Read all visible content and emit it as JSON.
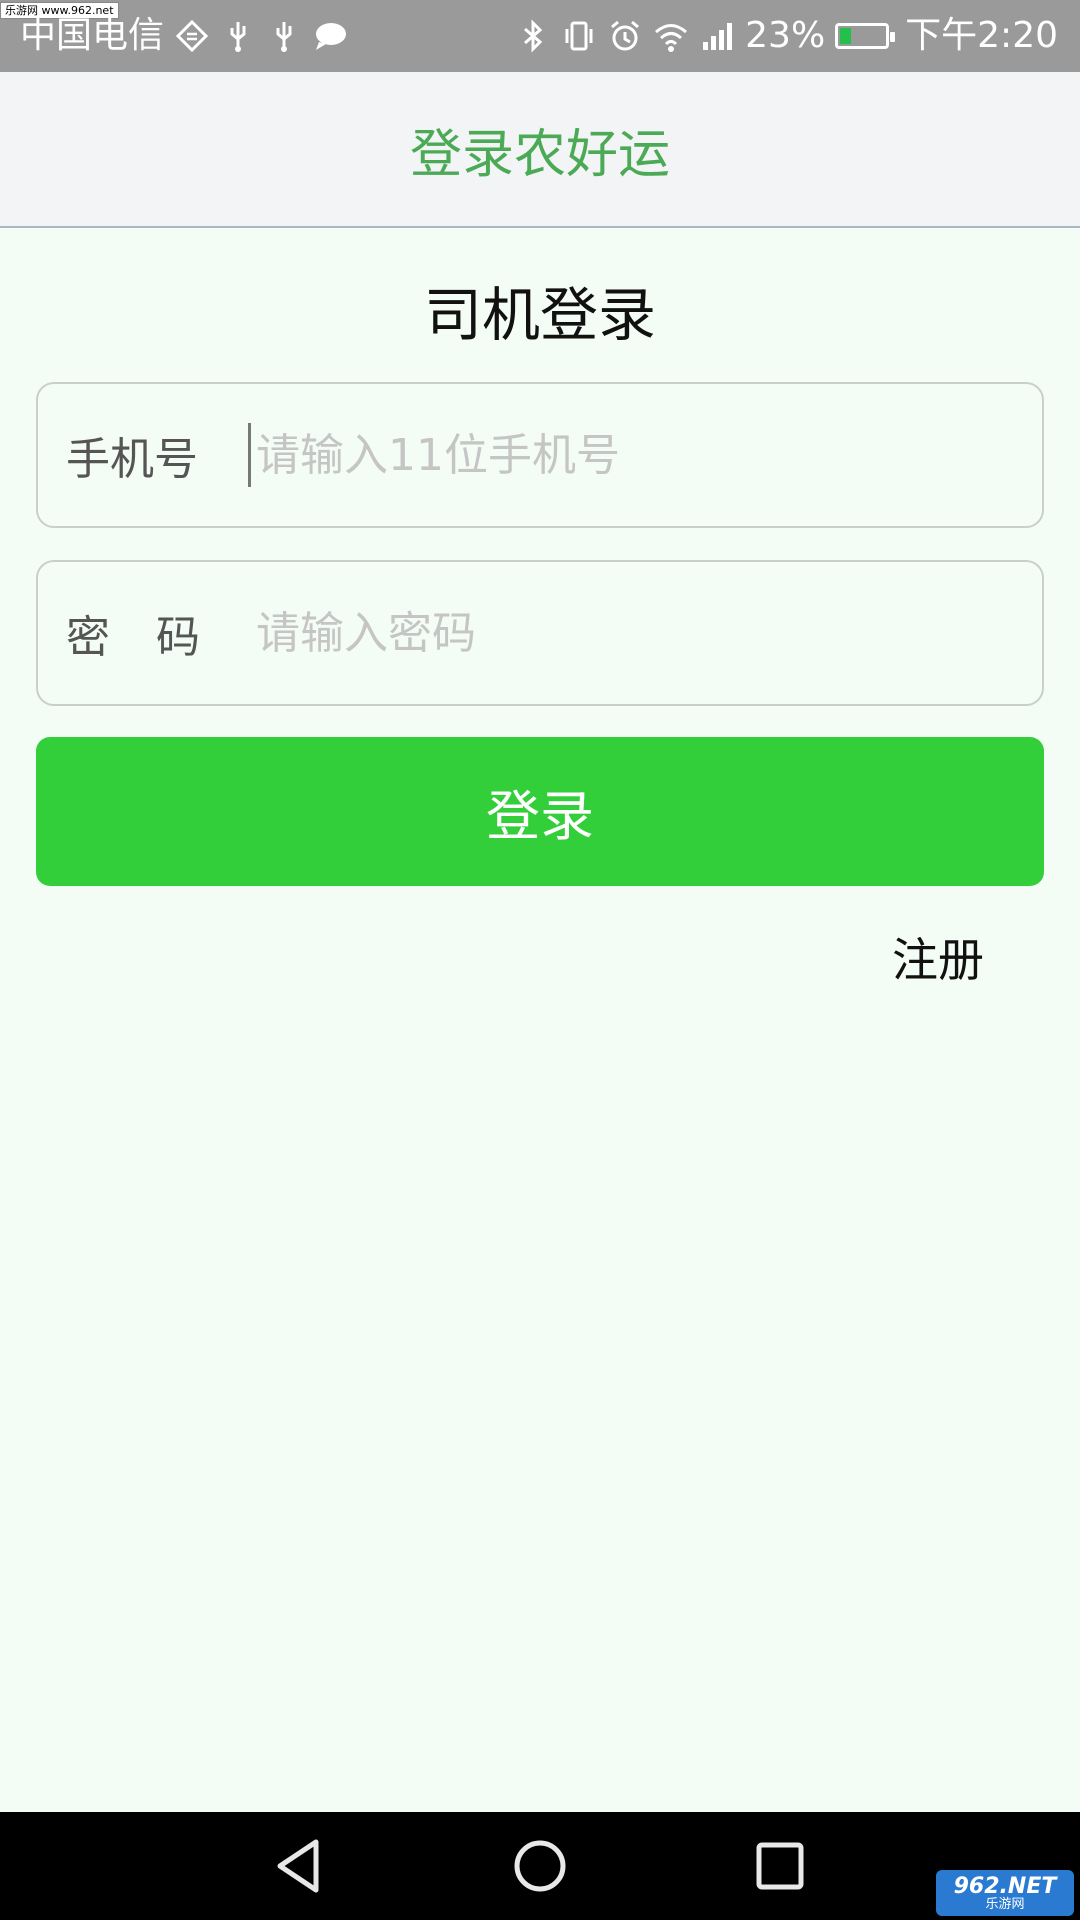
{
  "status_bar": {
    "watermark": "乐游网 www.962.net",
    "carrier": "中国电信",
    "battery_percent": "23%",
    "battery_level": 0.23,
    "clock": "下午2:20",
    "icons": [
      "nfc-icon",
      "usb-icon",
      "usb-icon",
      "message-icon",
      "bluetooth-icon",
      "vibrate-icon",
      "alarm-icon",
      "wifi-icon",
      "signal-icon",
      "battery-icon"
    ]
  },
  "header": {
    "title": "登录农好运"
  },
  "login": {
    "heading": "司机登录",
    "phone_label": "手机号",
    "phone_placeholder": "请输入11位手机号",
    "password_label": "密码",
    "password_placeholder": "请输入密码",
    "submit_label": "登录",
    "register_label": "注册"
  },
  "nav_bar": {
    "icons": [
      "back-icon",
      "home-icon",
      "recent-apps-icon"
    ],
    "watermark_top": "962.NET",
    "watermark_bottom": "乐游网"
  },
  "colors": {
    "title_green": "#4caa56",
    "button_green": "#33cf3a",
    "page_background": "#f3fcf5",
    "status_bar": "#9a9a9a"
  }
}
